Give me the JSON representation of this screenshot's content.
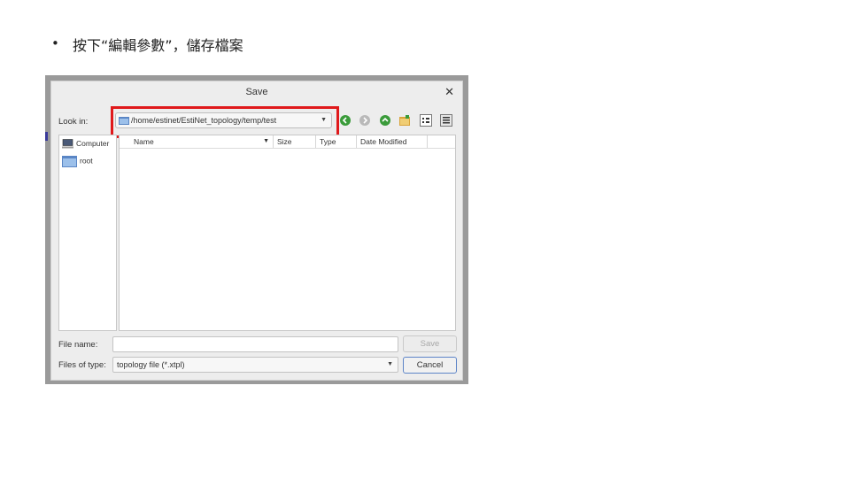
{
  "slide": {
    "bullet": "•",
    "instruction": "按下“編輯參數”，儲存檔案"
  },
  "dialog": {
    "title": "Save",
    "close_glyph": "✕",
    "look_in_label": "Look in:",
    "look_in_path": "/home/estinet/EstiNet_topology/temp/test",
    "toolbar_icons": [
      "back-icon",
      "forward-icon",
      "parent-folder-icon",
      "new-folder-icon",
      "list-view-icon",
      "detail-view-icon"
    ],
    "places": [
      {
        "label": "Computer",
        "icon": "computer-icon"
      },
      {
        "label": "root",
        "icon": "folder-icon"
      }
    ],
    "columns": [
      "Name",
      "Size",
      "Type",
      "Date Modified"
    ],
    "file_name_label": "File name:",
    "file_name_value": "",
    "save_button": "Save",
    "files_of_type_label": "Files of type:",
    "files_of_type_value": "topology file (*.xtpl)",
    "cancel_button": "Cancel"
  },
  "colors": {
    "highlight": "#e0191b",
    "dialog_bg": "#ededed",
    "screenshot_frame": "#9a9a9a"
  }
}
